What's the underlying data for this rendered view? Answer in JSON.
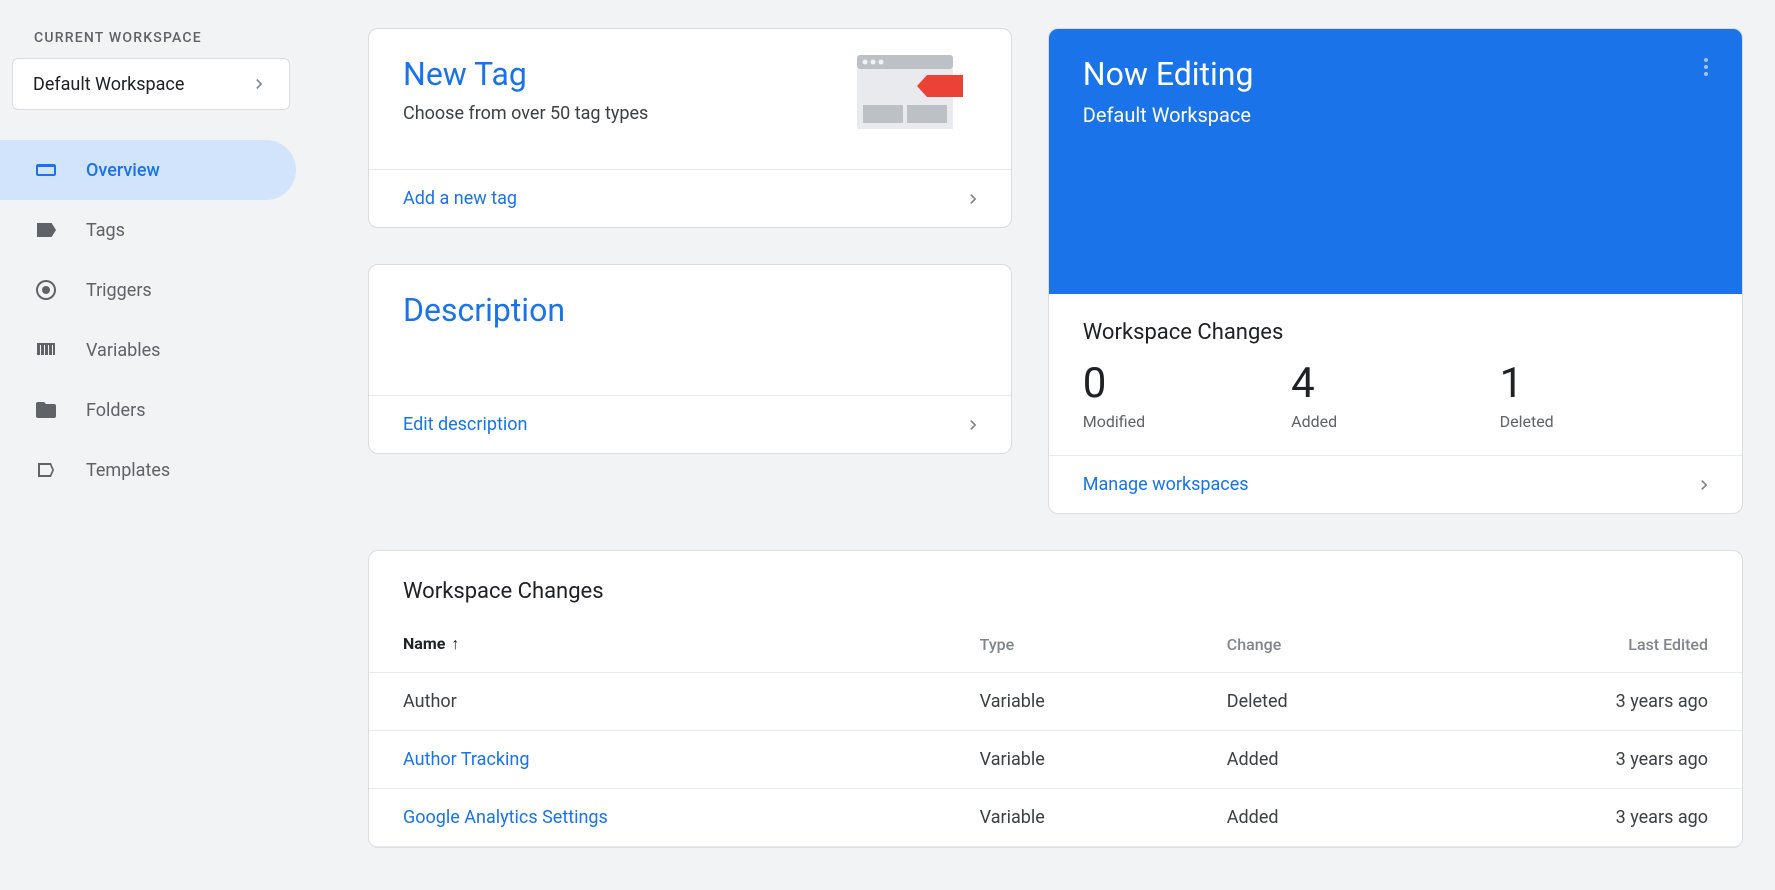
{
  "sidebar": {
    "workspace_label": "CURRENT WORKSPACE",
    "workspace_name": "Default Workspace",
    "items": [
      {
        "label": "Overview",
        "icon": "overview-icon",
        "active": true
      },
      {
        "label": "Tags",
        "icon": "tag-icon",
        "active": false
      },
      {
        "label": "Triggers",
        "icon": "trigger-icon",
        "active": false
      },
      {
        "label": "Variables",
        "icon": "variables-icon",
        "active": false
      },
      {
        "label": "Folders",
        "icon": "folder-icon",
        "active": false
      },
      {
        "label": "Templates",
        "icon": "template-icon",
        "active": false
      }
    ]
  },
  "newtag": {
    "title": "New Tag",
    "subtitle": "Choose from over 50 tag types",
    "link": "Add a new tag"
  },
  "description": {
    "title": "Description",
    "link": "Edit description"
  },
  "editing": {
    "title": "Now Editing",
    "subtitle": "Default Workspace",
    "changes_title": "Workspace Changes",
    "stats": [
      {
        "value": "0",
        "label": "Modified"
      },
      {
        "value": "4",
        "label": "Added"
      },
      {
        "value": "1",
        "label": "Deleted"
      }
    ],
    "manage_link": "Manage workspaces"
  },
  "changes_table": {
    "title": "Workspace Changes",
    "headers": {
      "name": "Name",
      "type": "Type",
      "change": "Change",
      "last": "Last Edited"
    },
    "rows": [
      {
        "name": "Author",
        "type": "Variable",
        "change": "Deleted",
        "last": "3 years ago",
        "link": false
      },
      {
        "name": "Author Tracking",
        "type": "Variable",
        "change": "Added",
        "last": "3 years ago",
        "link": true
      },
      {
        "name": "Google Analytics Settings",
        "type": "Variable",
        "change": "Added",
        "last": "3 years ago",
        "link": true
      }
    ]
  }
}
